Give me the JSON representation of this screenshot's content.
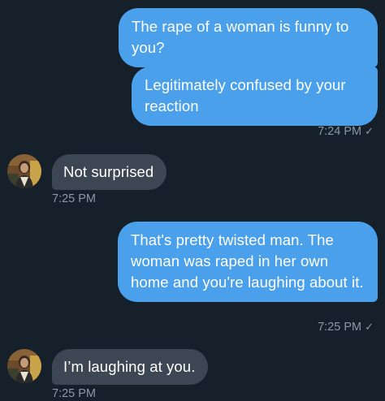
{
  "messages": [
    {
      "text": "The rape of a woman is funny to you?"
    },
    {
      "text": "Legitimately confused by your reaction"
    },
    {
      "text": "Not surprised"
    },
    {
      "text": "That's pretty twisted man. The woman was raped in her own home and you're laughing about it."
    },
    {
      "text": "I’m laughing at you."
    }
  ],
  "timestamps": {
    "t1": "7:24 PM",
    "t2": "7:25 PM",
    "t3": "7:25 PM",
    "t4": "7:25 PM"
  },
  "read_check": "✓",
  "colors": {
    "background": "#15202b",
    "outgoing_bubble": "#4aa0eb",
    "incoming_bubble": "#3d4753",
    "meta_text": "#8b98a5"
  },
  "icons": {
    "avatar": "user-avatar-icon",
    "read_receipt": "check-icon"
  }
}
